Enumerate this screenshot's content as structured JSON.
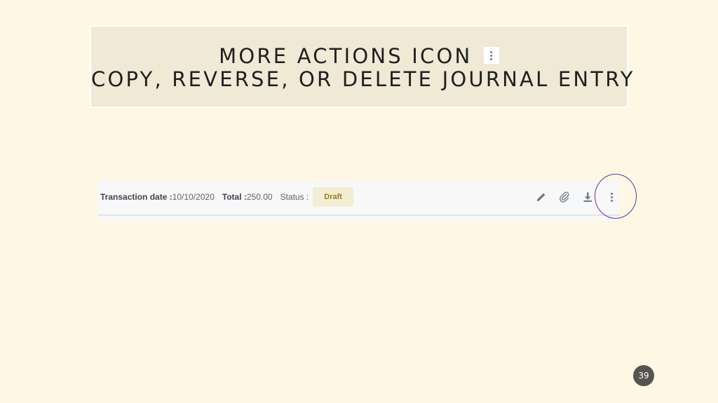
{
  "slide": {
    "title_line1": "MORE ACTIONS ICON",
    "title_line2": "COPY, REVERSE, OR DELETE JOURNAL ENTRY",
    "page_number": "39"
  },
  "entry_bar": {
    "transaction_date_label": "Transaction date :",
    "transaction_date_value": "10/10/2020",
    "total_label": "Total :",
    "total_value": "250.00",
    "status_label": "Status :",
    "status_badge": "Draft",
    "icons": [
      "pencil-icon",
      "paperclip-icon",
      "download-icon",
      "more-vertical-icon"
    ]
  },
  "colors": {
    "background": "#fdf7e4",
    "title_box": "#efe9d6",
    "highlight_ring": "#6b2fa1",
    "badge_bg": "#f3edd3",
    "badge_text": "#9c7b1a"
  }
}
